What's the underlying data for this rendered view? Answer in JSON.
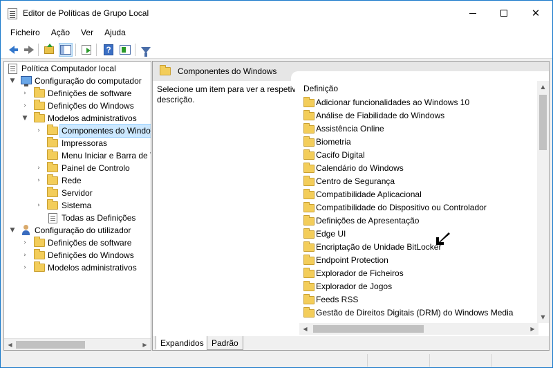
{
  "window": {
    "title": "Editor de Políticas de Grupo Local",
    "icon": "gpedit-icon"
  },
  "menu": [
    "Ficheiro",
    "Ação",
    "Ver",
    "Ajuda"
  ],
  "toolbar": {
    "buttons": [
      "back-icon",
      "forward-icon",
      "up-folder-icon",
      "show-hide-pane-icon",
      "export-list-icon",
      "help-icon",
      "properties-icon",
      "filter-icon"
    ]
  },
  "tree": {
    "root": "Política Computador local",
    "computer_config": "Configuração do computador",
    "cc_software": "Definições de software",
    "cc_windows": "Definições do Windows",
    "cc_admin": "Modelos administrativos",
    "admin_children": [
      "Componentes do Windows",
      "Impressoras",
      "Menu Iniciar e Barra de Tarefas",
      "Painel de Controlo",
      "Rede",
      "Servidor",
      "Sistema",
      "Todas as Definições"
    ],
    "user_config": "Configuração do utilizador",
    "uc_software": "Definições de software",
    "uc_windows": "Definições do Windows",
    "uc_admin": "Modelos administrativos"
  },
  "right": {
    "header_title": "Componentes do Windows",
    "description_line1": "Selecione um item para ver a respetiva",
    "description_line2": "descrição.",
    "column_header": "Definição",
    "items": [
      "Adicionar funcionalidades ao Windows 10",
      "Análise de Fiabilidade do Windows",
      "Assistência Online",
      "Biometria",
      "Cacifo Digital",
      "Calendário do Windows",
      "Centro de Segurança",
      "Compatibilidade Aplicacional",
      "Compatibilidade do Dispositivo ou Controlador",
      "Definições de Apresentação",
      "Edge UI",
      "Encriptação de Unidade BitLocker",
      "Endpoint Protection",
      "Explorador de Ficheiros",
      "Explorador de Jogos",
      "Feeds RSS",
      "Gestão de Direitos Digitais (DRM) do Windows Media"
    ]
  },
  "tabs": [
    "Expandidos",
    "Padrão"
  ],
  "colors": {
    "selection": "#cce8ff",
    "folder": "#f3cd5a",
    "accent": "#1979ca"
  }
}
